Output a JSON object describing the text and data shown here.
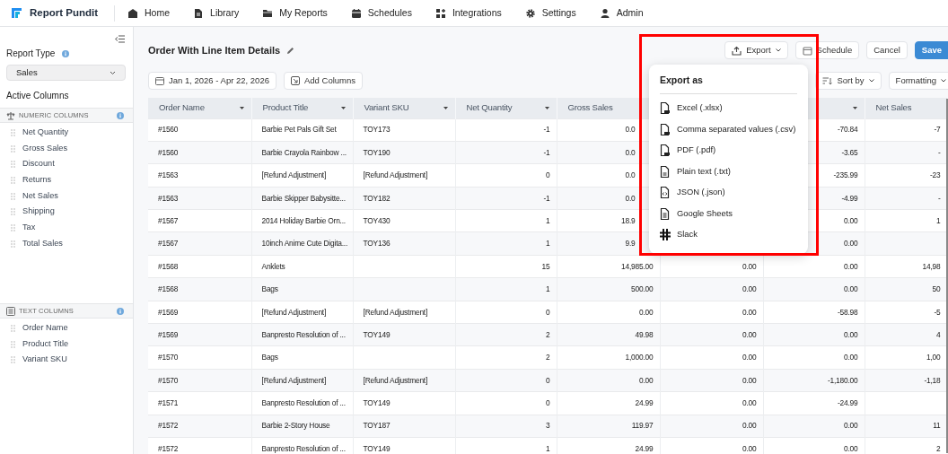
{
  "app": {
    "name": "Report Pundit"
  },
  "nav": [
    {
      "label": "Home",
      "kind": "home"
    },
    {
      "label": "Library",
      "kind": "library"
    },
    {
      "label": "My Reports",
      "kind": "folder"
    },
    {
      "label": "Schedules",
      "kind": "calendar"
    },
    {
      "label": "Integrations",
      "kind": "grid"
    },
    {
      "label": "Settings",
      "kind": "gear"
    },
    {
      "label": "Admin",
      "kind": "user"
    }
  ],
  "sidebar": {
    "report_type_label": "Report Type",
    "report_type_value": "Sales",
    "active_columns_label": "Active Columns",
    "groups": [
      {
        "kind": "numeric",
        "title": "NUMERIC COLUMNS",
        "items": [
          "Net Quantity",
          "Gross Sales",
          "Discount",
          "Returns",
          "Net Sales",
          "Shipping",
          "Tax",
          "Total Sales"
        ]
      },
      {
        "kind": "text",
        "title": "TEXT COLUMNS",
        "items": [
          "Order Name",
          "Product Title",
          "Variant SKU"
        ]
      }
    ]
  },
  "report": {
    "title": "Order With Line Item Details",
    "actions": [
      {
        "label": "Export",
        "kind": "export"
      },
      {
        "label": "Schedule",
        "kind": "schedule"
      },
      {
        "label": "Cancel",
        "kind": "plain"
      },
      {
        "label": "Save",
        "kind": "primary"
      }
    ],
    "date_range": "Jan 1, 2026 - Apr 22, 2026",
    "add_columns": "Add Columns",
    "sort_by": "Sort by",
    "formatting": "Formatting"
  },
  "table": {
    "columns": [
      {
        "label": "Order Name",
        "sort_caret": true
      },
      {
        "label": "Product Title",
        "sort_caret": true
      },
      {
        "label": "Variant SKU",
        "sort_caret": true
      },
      {
        "label": "Net Quantity",
        "sort_caret": true
      },
      {
        "label": "Gross Sales",
        "sort_caret": false
      },
      null,
      {
        "sort_caret": true
      },
      {
        "label": "Net Sales",
        "sort_caret": false
      }
    ],
    "rows": [
      {
        "under_menu": true,
        "cells": [
          "#1560",
          "Barbie Pet Pals Gift Set",
          "TOY173",
          "-1",
          "0.0",
          null,
          "-70.84",
          "-7"
        ]
      },
      {
        "under_menu": true,
        "cells": [
          "#1560",
          "Barbie Crayola Rainbow ...",
          "TOY190",
          "-1",
          "0.0",
          null,
          "-3.65",
          "-"
        ]
      },
      {
        "under_menu": true,
        "cells": [
          "#1563",
          "[Refund Adjustment]",
          "[Refund Adjustment]",
          "0",
          "0.0",
          null,
          "-235.99",
          "-23"
        ]
      },
      {
        "under_menu": true,
        "cells": [
          "#1563",
          "Barbie Skipper Babysitte...",
          "TOY182",
          "-1",
          "0.0",
          null,
          "-4.99",
          "-"
        ]
      },
      {
        "under_menu": true,
        "cells": [
          "#1567",
          "2014 Holiday Barbie Orn...",
          "TOY430",
          "1",
          "18.9",
          null,
          "0.00",
          "1"
        ]
      },
      {
        "under_menu": true,
        "cells": [
          "#1567",
          "10inch Anime Cute Digita...",
          "TOY136",
          "1",
          "9.9",
          null,
          "0.00",
          null
        ]
      },
      {
        "under_menu": false,
        "cells": [
          "#1568",
          "Anklets",
          null,
          "15",
          "14,985.00",
          "0.00",
          "0.00",
          "14,98"
        ]
      },
      {
        "under_menu": false,
        "cells": [
          "#1568",
          "Bags",
          null,
          "1",
          "500.00",
          "0.00",
          "0.00",
          "50"
        ]
      },
      {
        "under_menu": false,
        "cells": [
          "#1569",
          "[Refund Adjustment]",
          "[Refund Adjustment]",
          "0",
          "0.00",
          "0.00",
          "-58.98",
          "-5"
        ]
      },
      {
        "under_menu": false,
        "cells": [
          "#1569",
          "Banpresto Resolution of ...",
          "TOY149",
          "2",
          "49.98",
          "0.00",
          "0.00",
          "4"
        ]
      },
      {
        "under_menu": false,
        "cells": [
          "#1570",
          "Bags",
          null,
          "2",
          "1,000.00",
          "0.00",
          "0.00",
          "1,00"
        ]
      },
      {
        "under_menu": false,
        "cells": [
          "#1570",
          "[Refund Adjustment]",
          "[Refund Adjustment]",
          "0",
          "0.00",
          "0.00",
          "-1,180.00",
          "-1,18"
        ]
      },
      {
        "under_menu": false,
        "cells": [
          "#1571",
          "Banpresto Resolution of ...",
          "TOY149",
          "0",
          "24.99",
          "0.00",
          "-24.99",
          null
        ]
      },
      {
        "under_menu": false,
        "cells": [
          "#1572",
          "Barbie 2-Story House",
          "TOY187",
          "3",
          "119.97",
          "0.00",
          "0.00",
          "11"
        ]
      },
      {
        "under_menu": false,
        "cells": [
          "#1572",
          "Banpresto Resolution of ...",
          "TOY149",
          "1",
          "24.99",
          "0.00",
          "0.00",
          "2"
        ]
      }
    ]
  },
  "export_menu": {
    "title": "Export as",
    "items": [
      {
        "label": "Excel (.xlsx)",
        "kind": "file"
      },
      {
        "label": "Comma separated values (.csv)",
        "kind": "file"
      },
      {
        "label": "PDF (.pdf)",
        "kind": "file"
      },
      {
        "label": "Plain text (.txt)",
        "kind": "doc"
      },
      {
        "label": "JSON (.json)",
        "kind": "code"
      },
      {
        "label": "Google Sheets",
        "kind": "sheet"
      },
      {
        "label": "Slack",
        "kind": "slack"
      }
    ]
  }
}
